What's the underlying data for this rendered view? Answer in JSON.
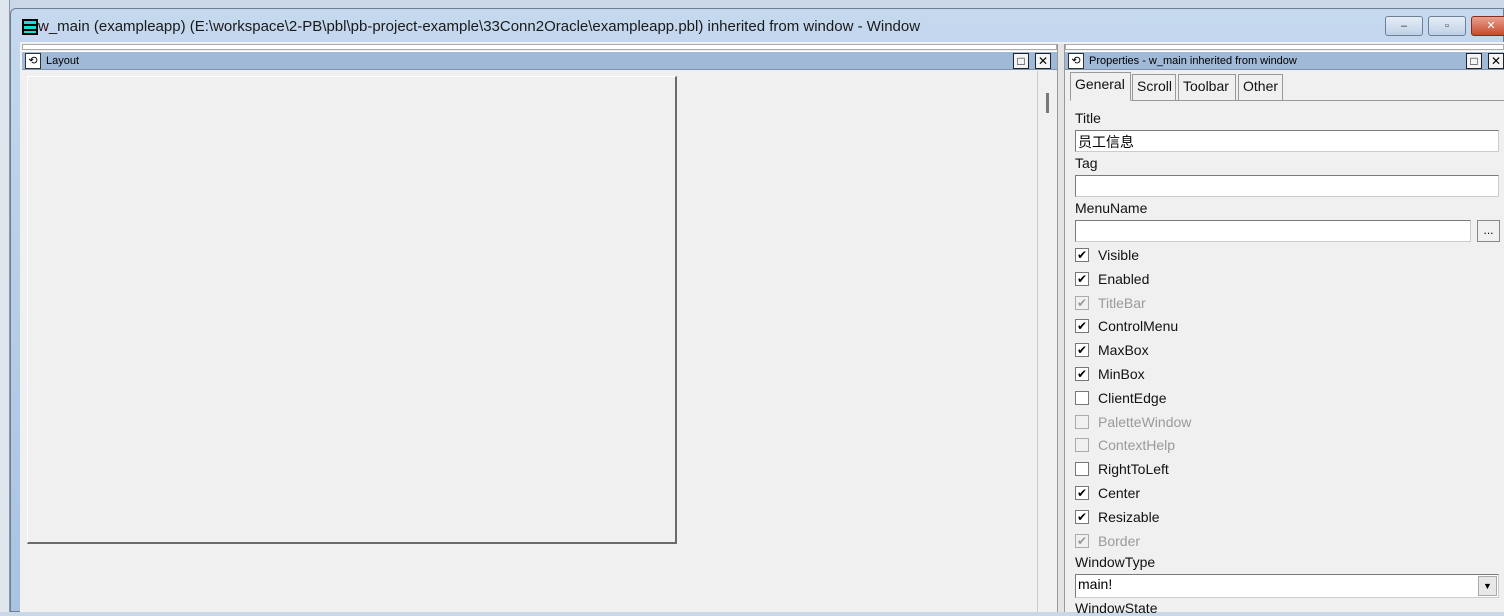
{
  "window": {
    "title": "w_main (exampleapp) (E:\\workspace\\2-PB\\pbl\\pb-project-example\\33Conn2Oracle\\exampleapp.pbl) inherited from window - Window",
    "minimize": "–",
    "maximize": "▫",
    "close": "✕"
  },
  "layout": {
    "title": "Layout"
  },
  "properties": {
    "title": "Properties - w_main inherited from window",
    "tabs": [
      "General",
      "Scroll",
      "Toolbar",
      "Other"
    ],
    "fields": {
      "title_label": "Title",
      "title_value": "员工信息",
      "tag_label": "Tag",
      "tag_value": "",
      "menuname_label": "MenuName",
      "menuname_value": "",
      "browse": "...",
      "windowtype_label": "WindowType",
      "windowtype_value": "main!",
      "windowstate_label": "WindowState"
    },
    "checkboxes": [
      {
        "label": "Visible",
        "checked": true,
        "enabled": true
      },
      {
        "label": "Enabled",
        "checked": true,
        "enabled": true
      },
      {
        "label": "TitleBar",
        "checked": true,
        "enabled": false
      },
      {
        "label": "ControlMenu",
        "checked": true,
        "enabled": true
      },
      {
        "label": "MaxBox",
        "checked": true,
        "enabled": true
      },
      {
        "label": "MinBox",
        "checked": true,
        "enabled": true
      },
      {
        "label": "ClientEdge",
        "checked": false,
        "enabled": true
      },
      {
        "label": "PaletteWindow",
        "checked": false,
        "enabled": false
      },
      {
        "label": "ContextHelp",
        "checked": false,
        "enabled": false
      },
      {
        "label": "RightToLeft",
        "checked": false,
        "enabled": true
      },
      {
        "label": "Center",
        "checked": true,
        "enabled": true
      },
      {
        "label": "Resizable",
        "checked": true,
        "enabled": true
      },
      {
        "label": "Border",
        "checked": true,
        "enabled": false
      }
    ]
  }
}
